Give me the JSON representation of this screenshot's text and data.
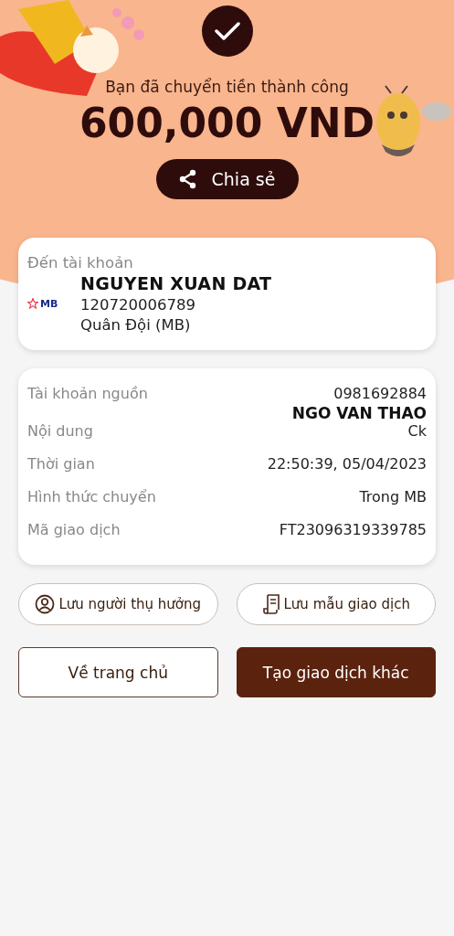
{
  "header": {
    "message": "Bạn đã chuyển tiền thành công",
    "amount": "600,000 VND",
    "share_button": "Chia sẻ"
  },
  "recipient": {
    "label": "Đến tài khoản",
    "bank_logo": "MB",
    "name": "NGUYEN XUAN DAT",
    "account_number": "120720006789",
    "bank_name": "Quân Đội (MB)"
  },
  "details": [
    {
      "label": "Tài khoản nguồn",
      "values": [
        "0981692884",
        "NGO VAN THAO"
      ]
    },
    {
      "label": "Nội dung",
      "values": [
        "Ck"
      ]
    },
    {
      "label": "Thời gian",
      "values": [
        "22:50:39, 05/04/2023"
      ]
    },
    {
      "label": "Hình thức chuyển",
      "values": [
        "Trong MB"
      ]
    },
    {
      "label": "Mã giao dịch",
      "values": [
        "FT23096319339785"
      ]
    }
  ],
  "save_actions": [
    {
      "kind": "person",
      "label": "Lưu người thụ hưởng"
    },
    {
      "kind": "template",
      "label": "Lưu mẫu giao dịch"
    }
  ],
  "main_actions": [
    {
      "kind": "outline",
      "label": "Về trang chủ"
    },
    {
      "kind": "filled",
      "label": "Tạo giao dịch khác"
    }
  ]
}
